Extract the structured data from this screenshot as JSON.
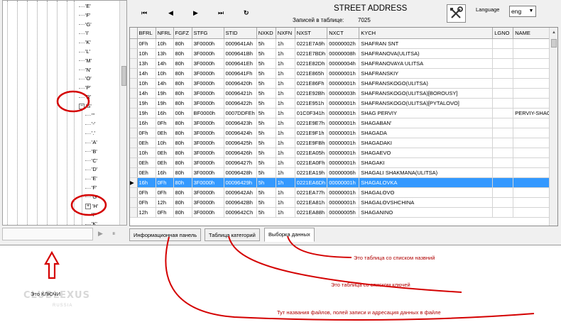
{
  "toolbar": {
    "first_icon": "⏮",
    "prev_icon": "◀",
    "next_icon": "▶",
    "last_icon": "⏭",
    "refresh_icon": "↻",
    "title": "STREET ADDRESS",
    "record_label": "Записей в таблице:",
    "record_count": "7025",
    "language_label": "Language",
    "language_value": "eng"
  },
  "tree": {
    "items": [
      {
        "label": "'E'",
        "expander": ""
      },
      {
        "label": "'F'",
        "expander": ""
      },
      {
        "label": "'G'",
        "expander": ""
      },
      {
        "label": "'I'",
        "expander": ""
      },
      {
        "label": "'K'",
        "expander": ""
      },
      {
        "label": "'L'",
        "expander": ""
      },
      {
        "label": "'M'",
        "expander": ""
      },
      {
        "label": "'N'",
        "expander": ""
      },
      {
        "label": "'O'",
        "expander": ""
      },
      {
        "label": "'P'",
        "expander": ""
      },
      {
        "label": "'R'",
        "expander": ""
      },
      {
        "label": "'S'",
        "expander": "−"
      },
      {
        "label": "'''",
        "expander": ""
      },
      {
        "label": "'-'",
        "expander": ""
      },
      {
        "label": "'.'",
        "expander": ""
      },
      {
        "label": "'A'",
        "expander": ""
      },
      {
        "label": "'B'",
        "expander": ""
      },
      {
        "label": "'C'",
        "expander": ""
      },
      {
        "label": "'D'",
        "expander": ""
      },
      {
        "label": "'E'",
        "expander": ""
      },
      {
        "label": "'F'",
        "expander": ""
      },
      {
        "label": "'G'",
        "expander": ""
      },
      {
        "label": "'H'",
        "expander": "+"
      },
      {
        "label": "'I'",
        "expander": ""
      },
      {
        "label": "'K'",
        "expander": ""
      }
    ],
    "play_icon": "▶",
    "pause_icon": "⏸"
  },
  "grid": {
    "columns": [
      "BFRL",
      "NFRL",
      "FGFZ",
      "STFG",
      "STID",
      "NXKD",
      "NXFN",
      "NXST",
      "NXCT",
      "KYCH",
      "LGNO",
      "NAME"
    ],
    "rows": [
      [
        "0Fh",
        "10h",
        "80h",
        "3F0000h",
        "0009641Ah",
        "5h",
        "1h",
        "0221E7A9h",
        "00000002h",
        "SHAFRAN SNT",
        "",
        ""
      ],
      [
        "10h",
        "13h",
        "80h",
        "3F0000h",
        "0009641Bh",
        "5h",
        "1h",
        "0221E7BDh",
        "00000008h",
        "SHAFRANOVA(ULITSA)",
        "",
        ""
      ],
      [
        "13h",
        "14h",
        "80h",
        "3F0000h",
        "0009641Eh",
        "5h",
        "1h",
        "0221E82Dh",
        "00000004h",
        "SHAFRANOVAYA ULITSA",
        "",
        ""
      ],
      [
        "14h",
        "10h",
        "80h",
        "3F0000h",
        "0009641Fh",
        "5h",
        "1h",
        "0221E865h",
        "00000001h",
        "SHAFRANSKIY",
        "",
        ""
      ],
      [
        "10h",
        "14h",
        "80h",
        "3F0000h",
        "00096420h",
        "5h",
        "1h",
        "0221E86Fh",
        "00000001h",
        "SHAFRANSKOGO(ULITSA)",
        "",
        ""
      ],
      [
        "14h",
        "19h",
        "80h",
        "3F0000h",
        "00096421h",
        "5h",
        "1h",
        "0221E92Bh",
        "00000003h",
        "SHAFRANSKOGO(ULITSA)[BOROUSY]",
        "",
        ""
      ],
      [
        "19h",
        "19h",
        "80h",
        "3F0000h",
        "00096422h",
        "5h",
        "1h",
        "0221E951h",
        "00000001h",
        "SHAFRANSKOGO(ULITSA)[PYTALOVO]",
        "",
        ""
      ],
      [
        "19h",
        "16h",
        "00h",
        "BF0000h",
        "0007DDFEh",
        "5h",
        "1h",
        "01C0F341h",
        "00000001h",
        "SHAG PERVIY",
        "",
        "PERVIY-SHAG"
      ],
      [
        "16h",
        "0Fh",
        "80h",
        "3F0000h",
        "00096423h",
        "5h",
        "1h",
        "0221E9E7h",
        "00000001h",
        "SHAGABAN'",
        "",
        ""
      ],
      [
        "0Fh",
        "0Eh",
        "80h",
        "3F0000h",
        "00096424h",
        "5h",
        "1h",
        "0221E9F1h",
        "00000001h",
        "SHAGADA",
        "",
        ""
      ],
      [
        "0Eh",
        "10h",
        "80h",
        "3F0000h",
        "00096425h",
        "5h",
        "1h",
        "0221E9FBh",
        "00000001h",
        "SHAGADAKI",
        "",
        ""
      ],
      [
        "10h",
        "0Eh",
        "80h",
        "3F0000h",
        "00096426h",
        "5h",
        "1h",
        "0221EA05h",
        "00000001h",
        "SHAGAEVO",
        "",
        ""
      ],
      [
        "0Eh",
        "0Eh",
        "80h",
        "3F0000h",
        "00096427h",
        "5h",
        "1h",
        "0221EA0Fh",
        "00000001h",
        "SHAGAKI",
        "",
        ""
      ],
      [
        "0Eh",
        "16h",
        "80h",
        "3F0000h",
        "00096428h",
        "5h",
        "1h",
        "0221EA19h",
        "00000006h",
        "SHAGALI SHAKMANA(ULITSA)",
        "",
        ""
      ],
      [
        "16h",
        "0Fh",
        "80h",
        "3F0000h",
        "00096429h",
        "5h",
        "1h",
        "0221EA6Dh",
        "00000001h",
        "SHAGALOVKA",
        "",
        ""
      ],
      [
        "0Fh",
        "0Fh",
        "80h",
        "3F0000h",
        "0009642Ah",
        "5h",
        "1h",
        "0221EA77h",
        "00000001h",
        "SHAGALOVO",
        "",
        ""
      ],
      [
        "0Fh",
        "12h",
        "80h",
        "3F0000h",
        "0009642Bh",
        "5h",
        "1h",
        "0221EA81h",
        "00000001h",
        "SHAGALOVSHCHINA",
        "",
        ""
      ],
      [
        "12h",
        "0Fh",
        "80h",
        "3F0000h",
        "0009642Ch",
        "5h",
        "1h",
        "0221EA88h",
        "00000005h",
        "SHAGANINO",
        "",
        ""
      ]
    ],
    "selected_index": 14
  },
  "tabs": [
    {
      "label": "Информационная панель"
    },
    {
      "label": "Таблица категорий"
    },
    {
      "label": "Выборка данных"
    }
  ],
  "annotations": {
    "names_table": "Это таблица со списком назвний",
    "keys_table": "Это таблица со списком ключей",
    "info_panel": "Тут названия файлов, полей записи и адресация данных в файле",
    "keys": "Это  КЛЮЧИ"
  },
  "watermark": {
    "logo": "CLUBLEXUS",
    "sub": "RUSSIA"
  },
  "colors": {
    "annotation": "#c00000",
    "selection": "#3399ff"
  }
}
